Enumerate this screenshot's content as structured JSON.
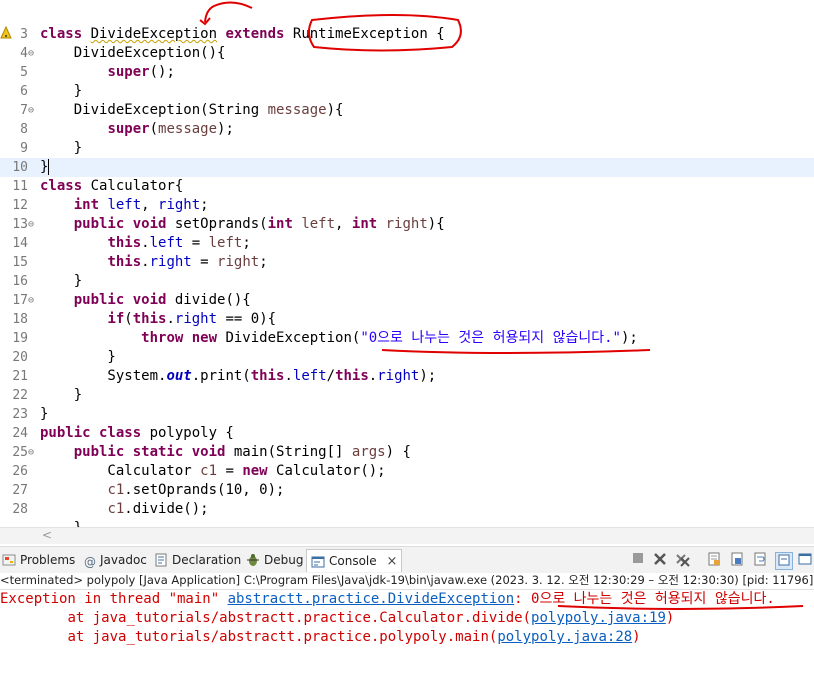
{
  "editor": {
    "lines": [
      {
        "n": "3",
        "fold": "",
        "tokens": [
          [
            "kw",
            "class "
          ],
          [
            "",
            "DivideException"
          ],
          [
            "",
            " "
          ],
          [
            "kw",
            "extends "
          ],
          [
            "",
            "RuntimeException "
          ],
          [
            "",
            "{"
          ]
        ]
      },
      {
        "n": "4",
        "fold": "⊖",
        "tokens": [
          [
            "",
            "    DivideException(){"
          ]
        ]
      },
      {
        "n": "5",
        "fold": "",
        "tokens": [
          [
            "",
            "        "
          ],
          [
            "kw",
            "super"
          ],
          [
            "",
            "();"
          ]
        ]
      },
      {
        "n": "6",
        "fold": "",
        "tokens": [
          [
            "",
            "    }"
          ]
        ]
      },
      {
        "n": "7",
        "fold": "⊖",
        "tokens": [
          [
            "",
            "    DivideException(String "
          ],
          [
            "var",
            "message"
          ],
          [
            "",
            "){"
          ]
        ]
      },
      {
        "n": "8",
        "fold": "",
        "tokens": [
          [
            "",
            "        "
          ],
          [
            "kw",
            "super"
          ],
          [
            "",
            "("
          ],
          [
            "var",
            "message"
          ],
          [
            "",
            ");"
          ]
        ]
      },
      {
        "n": "9",
        "fold": "",
        "tokens": [
          [
            "",
            "    }"
          ]
        ]
      },
      {
        "n": "10",
        "fold": "",
        "tokens": [
          [
            "",
            "}"
          ]
        ]
      },
      {
        "n": "11",
        "fold": "",
        "tokens": [
          [
            "kw",
            "class "
          ],
          [
            "",
            "Calculator{"
          ]
        ]
      },
      {
        "n": "12",
        "fold": "",
        "tokens": [
          [
            "",
            "    "
          ],
          [
            "kw",
            "int "
          ],
          [
            "fld",
            "left"
          ],
          [
            "",
            ", "
          ],
          [
            "fld",
            "right"
          ],
          [
            "",
            ";"
          ]
        ]
      },
      {
        "n": "13",
        "fold": "⊖",
        "tokens": [
          [
            "",
            "    "
          ],
          [
            "kw",
            "public void "
          ],
          [
            "",
            "setOprands("
          ],
          [
            "kw",
            "int "
          ],
          [
            "var",
            "left"
          ],
          [
            "",
            ", "
          ],
          [
            "kw",
            "int "
          ],
          [
            "var",
            "right"
          ],
          [
            "",
            "){"
          ]
        ]
      },
      {
        "n": "14",
        "fold": "",
        "tokens": [
          [
            "",
            "        "
          ],
          [
            "kw",
            "this"
          ],
          [
            "",
            "."
          ],
          [
            "fld",
            "left"
          ],
          [
            "",
            " = "
          ],
          [
            "var",
            "left"
          ],
          [
            "",
            ";"
          ]
        ]
      },
      {
        "n": "15",
        "fold": "",
        "tokens": [
          [
            "",
            "        "
          ],
          [
            "kw",
            "this"
          ],
          [
            "",
            "."
          ],
          [
            "fld",
            "right"
          ],
          [
            "",
            " = "
          ],
          [
            "var",
            "right"
          ],
          [
            "",
            ";"
          ]
        ]
      },
      {
        "n": "16",
        "fold": "",
        "tokens": [
          [
            "",
            "    }"
          ]
        ]
      },
      {
        "n": "17",
        "fold": "⊖",
        "tokens": [
          [
            "",
            "    "
          ],
          [
            "kw",
            "public void "
          ],
          [
            "",
            "divide(){"
          ]
        ]
      },
      {
        "n": "18",
        "fold": "",
        "tokens": [
          [
            "",
            "        "
          ],
          [
            "kw",
            "if"
          ],
          [
            "",
            "("
          ],
          [
            "kw",
            "this"
          ],
          [
            "",
            "."
          ],
          [
            "fld",
            "right"
          ],
          [
            "",
            " == 0){"
          ]
        ]
      },
      {
        "n": "19",
        "fold": "",
        "tokens": [
          [
            "",
            "            "
          ],
          [
            "kw",
            "throw new "
          ],
          [
            "",
            "DivideException("
          ],
          [
            "str",
            "\"0으로 나누는 것은 허용되지 않습니다.\""
          ],
          [
            "",
            ");"
          ]
        ]
      },
      {
        "n": "20",
        "fold": "",
        "tokens": [
          [
            "",
            "        }"
          ]
        ]
      },
      {
        "n": "21",
        "fold": "",
        "tokens": [
          [
            "",
            "        System."
          ],
          [
            "stc",
            "out"
          ],
          [
            "",
            ".print("
          ],
          [
            "kw",
            "this"
          ],
          [
            "",
            "."
          ],
          [
            "fld",
            "left"
          ],
          [
            "",
            "/"
          ],
          [
            "kw",
            "this"
          ],
          [
            "",
            "."
          ],
          [
            "fld",
            "right"
          ],
          [
            "",
            ");"
          ]
        ]
      },
      {
        "n": "22",
        "fold": "",
        "tokens": [
          [
            "",
            "    }"
          ]
        ]
      },
      {
        "n": "23",
        "fold": "",
        "tokens": [
          [
            "",
            "}"
          ]
        ]
      },
      {
        "n": "24",
        "fold": "",
        "tokens": [
          [
            "kw",
            "public class "
          ],
          [
            "",
            "polypoly {"
          ]
        ]
      },
      {
        "n": "25",
        "fold": "⊖",
        "tokens": [
          [
            "",
            "    "
          ],
          [
            "kw",
            "public static void "
          ],
          [
            "",
            "main(String[] "
          ],
          [
            "var",
            "args"
          ],
          [
            "",
            ") {"
          ]
        ]
      },
      {
        "n": "26",
        "fold": "",
        "tokens": [
          [
            "",
            "        Calculator "
          ],
          [
            "var",
            "c1"
          ],
          [
            "",
            " = "
          ],
          [
            "kw",
            "new "
          ],
          [
            "",
            "Calculator();"
          ]
        ]
      },
      {
        "n": "27",
        "fold": "",
        "tokens": [
          [
            "",
            "        "
          ],
          [
            "var",
            "c1"
          ],
          [
            "",
            ".setOprands(10, 0);"
          ]
        ]
      },
      {
        "n": "28",
        "fold": "",
        "tokens": [
          [
            "",
            "        "
          ],
          [
            "var",
            "c1"
          ],
          [
            "",
            ".divide();"
          ]
        ]
      },
      {
        "n": "",
        "fold": "",
        "tokens": [
          [
            "",
            "    }"
          ]
        ]
      }
    ]
  },
  "tabs": {
    "problems": "Problems",
    "javadoc": "Javadoc",
    "declaration": "Declaration",
    "debug": "Debug",
    "console": "Console",
    "console_close": "×"
  },
  "console": {
    "status": "<terminated> polypoly [Java Application] C:\\Program Files\\Java\\jdk-19\\bin\\javaw.exe  (2023. 3. 12. 오전 12:30:29 – 오전 12:30:30) [pid: 11796]",
    "line1_prefix": "Exception in thread \"main\" ",
    "line1_link": "abstractt.practice.DivideException",
    "line1_suffix": ": 0으로 나누는 것은 허용되지 않습니다.",
    "line2_prefix": "\tat java_tutorials/abstractt.practice.Calculator.divide(",
    "line2_link": "polypoly.java:19",
    "line2_suffix": ")",
    "line3_prefix": "\tat java_tutorials/abstractt.practice.polypoly.main(",
    "line3_link": "polypoly.java:28",
    "line3_suffix": ")"
  },
  "colors": {
    "keyword": "#7f0055",
    "string": "#2a00ff",
    "field": "#0000c0",
    "error_text": "#d10000",
    "link": "#0b5fc0",
    "annotation": "#e00000"
  },
  "icons": [
    "warning-icon",
    "fold-icon",
    "problems-icon",
    "javadoc-icon",
    "declaration-icon",
    "debug-icon",
    "console-icon",
    "close-icon",
    "terminate-icon",
    "remove-launch-icon",
    "remove-all-icon",
    "clear-console-icon",
    "scroll-lock-icon",
    "word-wrap-icon",
    "pin-icon",
    "display-selected-icon",
    "open-console-icon"
  ]
}
